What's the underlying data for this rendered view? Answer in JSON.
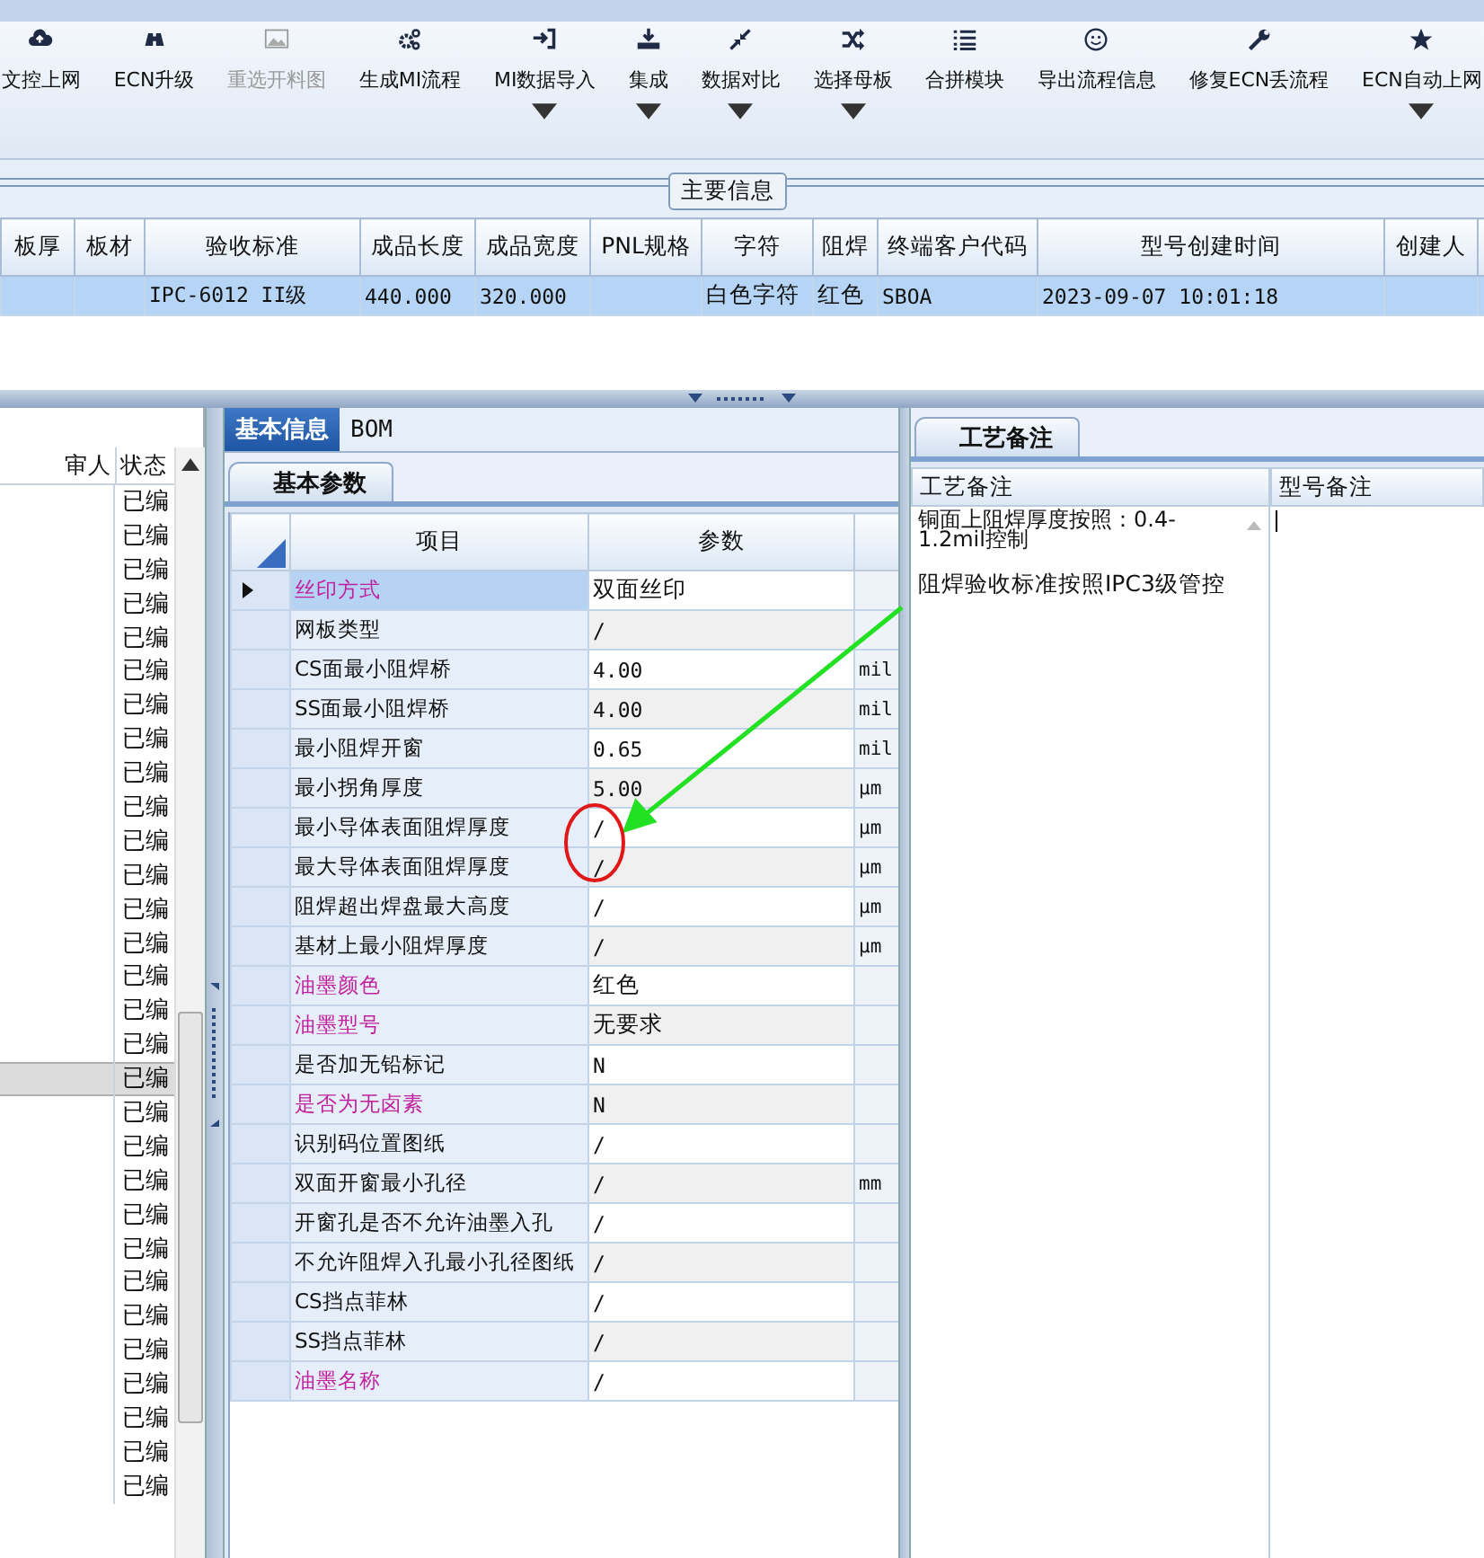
{
  "toolbar": [
    {
      "label": "文控上网",
      "dropdown": false,
      "disabled": false
    },
    {
      "label": "ECN升级",
      "dropdown": false,
      "disabled": false
    },
    {
      "label": "重选开料图",
      "dropdown": false,
      "disabled": true
    },
    {
      "label": "生成MI流程",
      "dropdown": false,
      "disabled": false
    },
    {
      "label": "MI数据导入",
      "dropdown": true,
      "disabled": false
    },
    {
      "label": "集成",
      "dropdown": true,
      "disabled": false
    },
    {
      "label": "数据对比",
      "dropdown": true,
      "disabled": false
    },
    {
      "label": "选择母板",
      "dropdown": true,
      "disabled": false
    },
    {
      "label": "合拼模块",
      "dropdown": false,
      "disabled": false
    },
    {
      "label": "导出流程信息",
      "dropdown": false,
      "disabled": false
    },
    {
      "label": "修复ECN丢流程",
      "dropdown": false,
      "disabled": false
    },
    {
      "label": "ECN自动上网",
      "dropdown": true,
      "disabled": false
    }
  ],
  "main_info": {
    "title": "主要信息",
    "columns": [
      "板厚",
      "板材",
      "验收标准",
      "成品长度",
      "成品宽度",
      "PNL规格",
      "字符",
      "阻焊",
      "终端客户代码",
      "型号创建时间",
      "创建人"
    ],
    "rows": [
      {
        "selected": true,
        "cells": [
          "",
          "",
          "IPC-6012 II级",
          "440.000",
          "320.000",
          "",
          "白色字符",
          "红色",
          "SBOA",
          "2023-09-07 10:01:18",
          ""
        ]
      }
    ]
  },
  "left_list": {
    "columns": [
      "审人",
      "状态"
    ],
    "rows": [
      {
        "status": "已编",
        "selected": false
      },
      {
        "status": "已编",
        "selected": false
      },
      {
        "status": "已编",
        "selected": false
      },
      {
        "status": "已编",
        "selected": false
      },
      {
        "status": "已编",
        "selected": false
      },
      {
        "status": "已编",
        "selected": false
      },
      {
        "status": "已编",
        "selected": false
      },
      {
        "status": "已编",
        "selected": false
      },
      {
        "status": "已编",
        "selected": false
      },
      {
        "status": "已编",
        "selected": false
      },
      {
        "status": "已编",
        "selected": false
      },
      {
        "status": "已编",
        "selected": false
      },
      {
        "status": "已编",
        "selected": false
      },
      {
        "status": "已编",
        "selected": false
      },
      {
        "status": "已编",
        "selected": false
      },
      {
        "status": "已编",
        "selected": false
      },
      {
        "status": "已编",
        "selected": false
      },
      {
        "status": "已编",
        "selected": true
      },
      {
        "status": "已编",
        "selected": false
      },
      {
        "status": "已编",
        "selected": false
      },
      {
        "status": "已编",
        "selected": false
      },
      {
        "status": "已编",
        "selected": false
      },
      {
        "status": "已编",
        "selected": false
      },
      {
        "status": "已编",
        "selected": false
      },
      {
        "status": "已编",
        "selected": false
      },
      {
        "status": "已编",
        "selected": false
      },
      {
        "status": "已编",
        "selected": false
      },
      {
        "status": "已编",
        "selected": false
      },
      {
        "status": "已编",
        "selected": false
      },
      {
        "status": "已编",
        "selected": false
      }
    ]
  },
  "detail_tabs": [
    {
      "label": "基本信息",
      "selected": true
    },
    {
      "label": "BOM",
      "selected": false
    }
  ],
  "params": {
    "tab": "基本参数",
    "columns": [
      "项目",
      "参数"
    ],
    "rows": [
      {
        "item": "丝印方式",
        "value": "双面丝印",
        "unit": "",
        "emphasized": true,
        "selected": true
      },
      {
        "item": "网板类型",
        "value": "/",
        "unit": "",
        "emphasized": false,
        "selected": false
      },
      {
        "item": "CS面最小阻焊桥",
        "value": "4.00",
        "unit": "mil",
        "emphasized": false,
        "selected": false
      },
      {
        "item": "SS面最小阻焊桥",
        "value": "4.00",
        "unit": "mil",
        "emphasized": false,
        "selected": false
      },
      {
        "item": "最小阻焊开窗",
        "value": "0.65",
        "unit": "mil",
        "emphasized": false,
        "selected": false
      },
      {
        "item": "最小拐角厚度",
        "value": "5.00",
        "unit": "µm",
        "emphasized": false,
        "selected": false
      },
      {
        "item": "最小导体表面阻焊厚度",
        "value": "/",
        "unit": "µm",
        "emphasized": false,
        "selected": false
      },
      {
        "item": "最大导体表面阻焊厚度",
        "value": "/",
        "unit": "µm",
        "emphasized": false,
        "selected": false
      },
      {
        "item": "阻焊超出焊盘最大高度",
        "value": "/",
        "unit": "µm",
        "emphasized": false,
        "selected": false
      },
      {
        "item": "基材上最小阻焊厚度",
        "value": "/",
        "unit": "µm",
        "emphasized": false,
        "selected": false
      },
      {
        "item": "油墨颜色",
        "value": "红色",
        "unit": "",
        "emphasized": true,
        "selected": false
      },
      {
        "item": "油墨型号",
        "value": "无要求",
        "unit": "",
        "emphasized": true,
        "selected": false
      },
      {
        "item": "是否加无铅标记",
        "value": "N",
        "unit": "",
        "emphasized": false,
        "selected": false
      },
      {
        "item": "是否为无卤素",
        "value": "N",
        "unit": "",
        "emphasized": true,
        "selected": false
      },
      {
        "item": "识别码位置图纸",
        "value": "/",
        "unit": "",
        "emphasized": false,
        "selected": false
      },
      {
        "item": "双面开窗最小孔径",
        "value": "/",
        "unit": "mm",
        "emphasized": false,
        "selected": false
      },
      {
        "item": "开窗孔是否不允许油墨入孔",
        "value": "/",
        "unit": "",
        "emphasized": false,
        "selected": false
      },
      {
        "item": "不允许阻焊入孔最小孔径图纸",
        "value": "/",
        "unit": "",
        "emphasized": false,
        "selected": false
      },
      {
        "item": "CS挡点菲林",
        "value": "/",
        "unit": "",
        "emphasized": false,
        "selected": false
      },
      {
        "item": "SS挡点菲林",
        "value": "/",
        "unit": "",
        "emphasized": false,
        "selected": false
      },
      {
        "item": "油墨名称",
        "value": "/",
        "unit": "",
        "emphasized": true,
        "selected": false
      }
    ]
  },
  "notes": {
    "tab": "工艺备注",
    "columns": [
      "工艺备注",
      "型号备注"
    ],
    "process_note": [
      "铜面上阻焊厚度按照：0.4-1.2mil控制",
      "阻焊验收标准按照IPC3级管控"
    ]
  }
}
